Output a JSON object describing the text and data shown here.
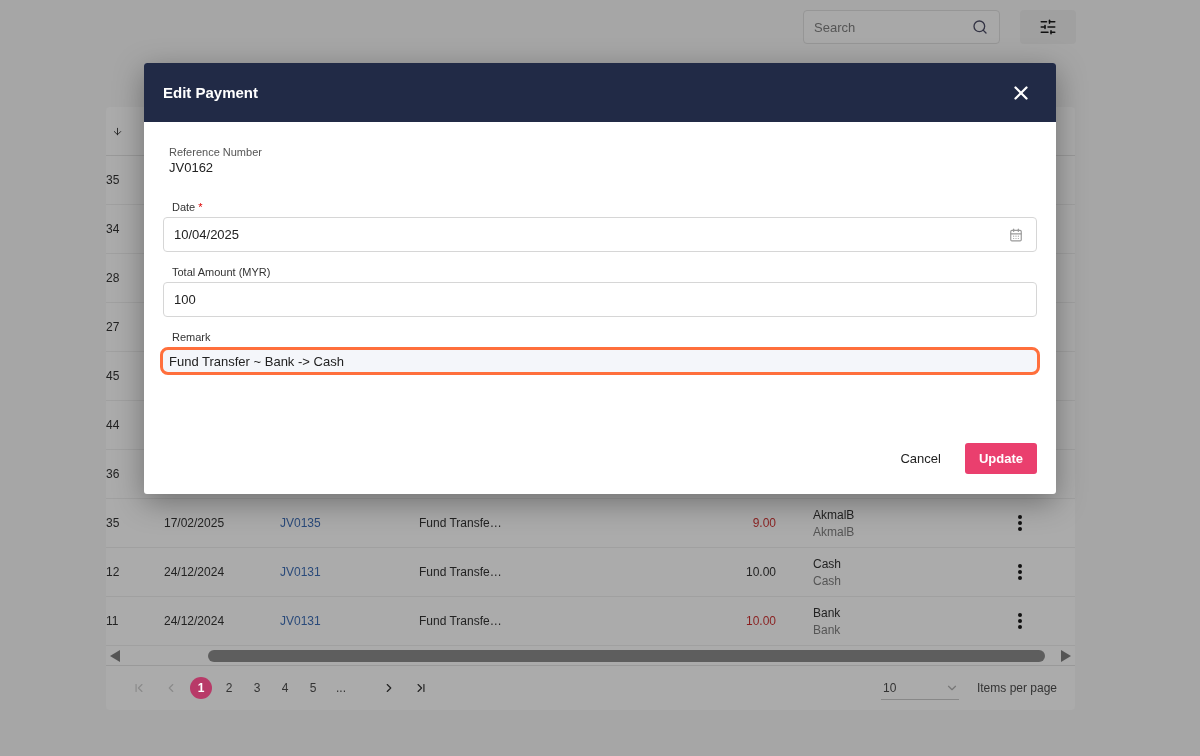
{
  "toolbar": {
    "search": {
      "placeholder": "Search"
    }
  },
  "table": {
    "rows": [
      {
        "column_1": "35"
      },
      {
        "column_1": "34"
      },
      {
        "column_1": "28"
      },
      {
        "column_1": "27"
      },
      {
        "column_1": "45"
      },
      {
        "column_1": "44"
      },
      {
        "column_1": "36"
      },
      {
        "column_1": "35",
        "date": "17/02/2025",
        "reference": "JV0135",
        "description": "Fund Transfe…",
        "amount": "9.00",
        "color": "#8a1f1f",
        "party": "AkmalB",
        "party_sub": "AkmalB"
      },
      {
        "column_1": "12",
        "date": "24/12/2024",
        "reference": "JV0131",
        "description": "Fund Transfe…",
        "amount": "10.00",
        "color": "#222222",
        "party": "Cash",
        "party_sub": "Cash"
      },
      {
        "column_1": "11",
        "date": "24/12/2024",
        "reference": "JV0131",
        "description": "Fund Transfe…",
        "amount": "10.00",
        "color": "#8a1f1f",
        "party": "Bank",
        "party_sub": "Bank"
      }
    ]
  },
  "pagination": {
    "pages": [
      {
        "label": "1",
        "selected": true
      },
      {
        "label": "2",
        "selected": false
      },
      {
        "label": "3",
        "selected": false
      },
      {
        "label": "4",
        "selected": false
      },
      {
        "label": "5",
        "selected": false
      },
      {
        "label": "...",
        "selected": false
      }
    ],
    "page_size": "10",
    "page_size_label": "Items per page"
  },
  "dialog": {
    "title": "Edit Payment",
    "reference_label": "Reference Number",
    "reference_value": "JV0162",
    "fields": [
      {
        "kind": "date",
        "label": "Date",
        "required_mark": "*",
        "value": "10/04/2025",
        "highlighted": false
      },
      {
        "kind": "text",
        "label": "Total Amount (MYR)",
        "value": "100",
        "highlighted": false
      },
      {
        "kind": "text",
        "label": "Remark",
        "value": "Fund Transfer ~ Bank -> Cash",
        "highlighted": true
      }
    ],
    "buttons": [
      {
        "kind": "text",
        "label": "Cancel"
      },
      {
        "kind": "primary",
        "label": "Update"
      }
    ]
  }
}
